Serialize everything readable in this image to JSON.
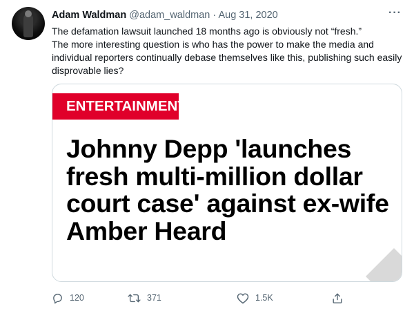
{
  "tweet": {
    "author_name": "Adam Waldman",
    "handle": "@adam_waldman",
    "separator": "·",
    "date": "Aug 31, 2020",
    "more_label": "···",
    "text_lines": [
      "The defamation lawsuit launched 18 months ago is obviously not “fresh.”",
      "The more interesting question is who has the power to make the media and individual reporters continually debase themselves like this, publishing such easily disprovable lies?"
    ]
  },
  "card": {
    "badge": "ENTERTAINMENT",
    "badge_color": "#e0002a",
    "headline": "Johnny Depp 'launches fresh multi-million dollar court case' against ex-wife Amber Heard"
  },
  "actions": {
    "reply": {
      "icon": "reply-icon",
      "count": "120"
    },
    "retweet": {
      "icon": "retweet-icon",
      "count": "371"
    },
    "like": {
      "icon": "heart-icon",
      "count": "1.5K"
    },
    "share": {
      "icon": "share-icon"
    }
  }
}
